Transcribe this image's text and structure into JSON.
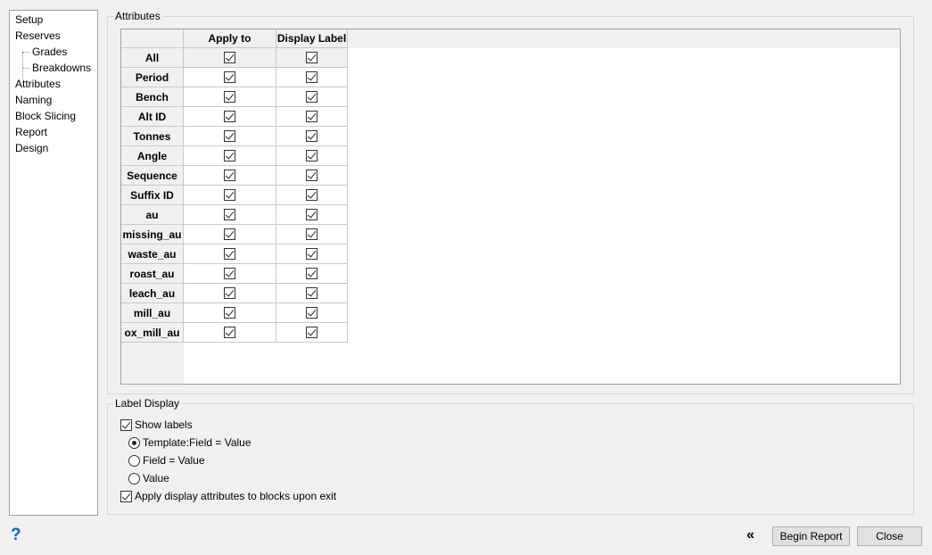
{
  "nav": {
    "items": [
      {
        "label": "Setup",
        "level": 0
      },
      {
        "label": "Reserves",
        "level": 0
      },
      {
        "label": "Grades",
        "level": 1
      },
      {
        "label": "Breakdowns",
        "level": 1
      },
      {
        "label": "Attributes",
        "level": 0,
        "selected": true
      },
      {
        "label": "Naming",
        "level": 0
      },
      {
        "label": "Block Slicing",
        "level": 0
      },
      {
        "label": "Report",
        "level": 0
      },
      {
        "label": "Design",
        "level": 0
      }
    ]
  },
  "attributes": {
    "group_title": "Attributes",
    "columns": [
      "Apply to",
      "Display Label"
    ],
    "rows": [
      {
        "name": "All",
        "apply": true,
        "display": true
      },
      {
        "name": "Period",
        "apply": true,
        "display": true
      },
      {
        "name": "Bench",
        "apply": true,
        "display": true
      },
      {
        "name": "Alt ID",
        "apply": true,
        "display": true
      },
      {
        "name": "Tonnes",
        "apply": true,
        "display": true
      },
      {
        "name": "Angle",
        "apply": true,
        "display": true
      },
      {
        "name": "Sequence",
        "apply": true,
        "display": true
      },
      {
        "name": "Suffix ID",
        "apply": true,
        "display": true
      },
      {
        "name": "au",
        "apply": true,
        "display": true
      },
      {
        "name": "missing_au",
        "apply": true,
        "display": true
      },
      {
        "name": "waste_au",
        "apply": true,
        "display": true
      },
      {
        "name": "roast_au",
        "apply": true,
        "display": true
      },
      {
        "name": "leach_au",
        "apply": true,
        "display": true
      },
      {
        "name": "mill_au",
        "apply": true,
        "display": true
      },
      {
        "name": "ox_mill_au",
        "apply": true,
        "display": true
      }
    ]
  },
  "label_display": {
    "group_title": "Label Display",
    "show_labels": {
      "label": "Show labels",
      "checked": true
    },
    "options": [
      {
        "label": "Template:Field = Value",
        "selected": true
      },
      {
        "label": "Field = Value",
        "selected": false
      },
      {
        "label": "Value",
        "selected": false
      }
    ],
    "apply_on_exit": {
      "label": "Apply display attributes to blocks upon exit",
      "checked": true
    }
  },
  "footer": {
    "help_glyph": "?",
    "collapse_glyph": "«",
    "begin_report": "Begin Report",
    "close": "Close"
  }
}
